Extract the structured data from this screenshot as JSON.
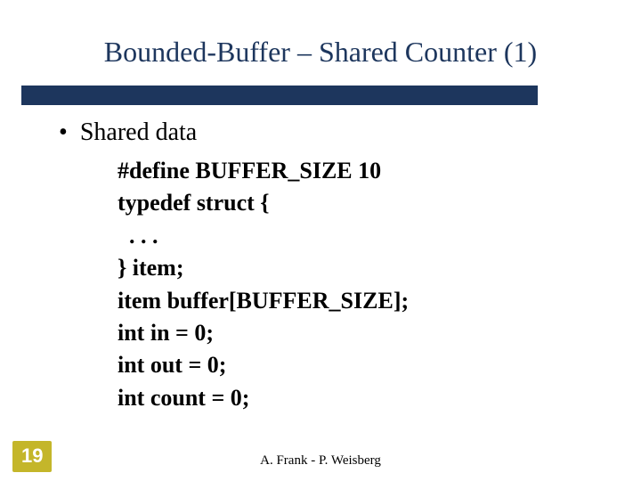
{
  "title": "Bounded-Buffer – Shared Counter (1)",
  "bullet": "Shared data",
  "code": {
    "l1": "#define BUFFER_SIZE 10",
    "l2": "typedef struct {",
    "l3": "  . . .",
    "l4": "} item;",
    "l5": "item buffer[BUFFER_SIZE];",
    "l6": "int in = 0;",
    "l7": "int out = 0;",
    "l8": "int count = 0;"
  },
  "page_number": "19",
  "footer": "A. Frank - P. Weisberg"
}
